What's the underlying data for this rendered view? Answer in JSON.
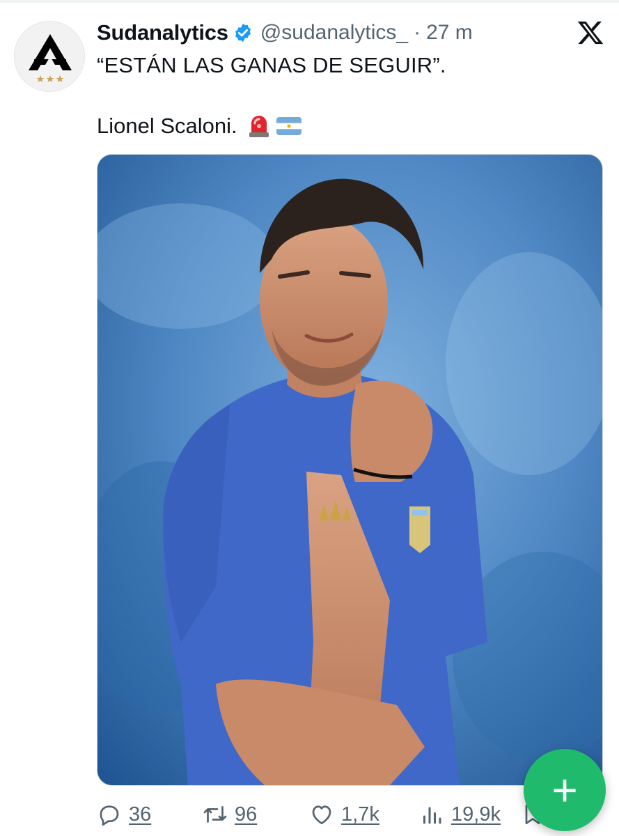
{
  "tweet": {
    "author": {
      "display_name": "Sudanalytics",
      "handle": "@sudanalytics_",
      "verified": true,
      "avatar_icon": "sudanalytics-logo-icon"
    },
    "separator": "·",
    "time": "27 m",
    "text_line1": "“ESTÁN LAS GANAS DE SEGUIR”.",
    "text_line2": "Lionel Scaloni.",
    "emojis": [
      "rotating-light-icon",
      "argentina-flag-icon"
    ],
    "media": {
      "type": "photo",
      "icon": "photo-icon"
    },
    "actions": {
      "replies": "36",
      "retweets": "96",
      "likes": "1,7k",
      "views": "19,9k"
    }
  },
  "platform_icon": "x-logo-icon",
  "fab": {
    "label": "+",
    "icon": "compose-plus-icon"
  },
  "colors": {
    "text": "#0f1419",
    "muted": "#536471",
    "verified": "#1d9bf0",
    "fab": "#1fba6b",
    "photo_background": "#4d84bf",
    "shirt": "#3f68c8"
  }
}
